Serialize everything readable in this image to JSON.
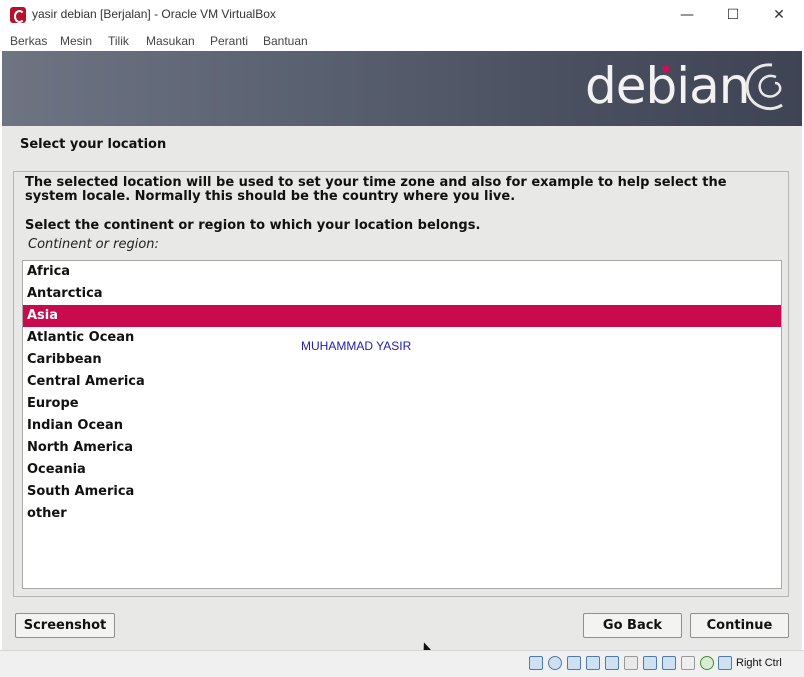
{
  "window": {
    "title": "yasir debian [Berjalan] - Oracle VM VirtualBox",
    "controls": {
      "minimize": "—",
      "maximize": "☐",
      "close": "✕"
    }
  },
  "menu": [
    "Berkas",
    "Mesin",
    "Tilik",
    "Masukan",
    "Peranti",
    "Bantuan"
  ],
  "installer": {
    "brand": "debian",
    "step_title": "Select your location",
    "description": "The selected location will be used to set your time zone and also for example to help select the system locale. Normally this should be the country where you live.",
    "prompt": "Select the continent or region to which your location belongs.",
    "field_label": "Continent or region:",
    "options": [
      "Africa",
      "Antarctica",
      "Asia",
      "Atlantic Ocean",
      "Caribbean",
      "Central America",
      "Europe",
      "Indian Ocean",
      "North America",
      "Oceania",
      "South America",
      "other"
    ],
    "selected": "Asia",
    "watermark": "MUHAMMAD YASIR",
    "buttons": {
      "screenshot": "Screenshot",
      "go_back": "Go Back",
      "continue": "Continue"
    },
    "accent_color": "#c90a4d"
  },
  "statusbar": {
    "icons": [
      "hard-disk-icon",
      "optical-drive-icon",
      "audio-icon",
      "network-icon",
      "usb-icon",
      "shared-folders-icon",
      "display-icon",
      "video-capture-icon",
      "recording-icon",
      "mouse-integration-icon",
      "keyboard-icon"
    ],
    "host_key": "Right Ctrl"
  }
}
